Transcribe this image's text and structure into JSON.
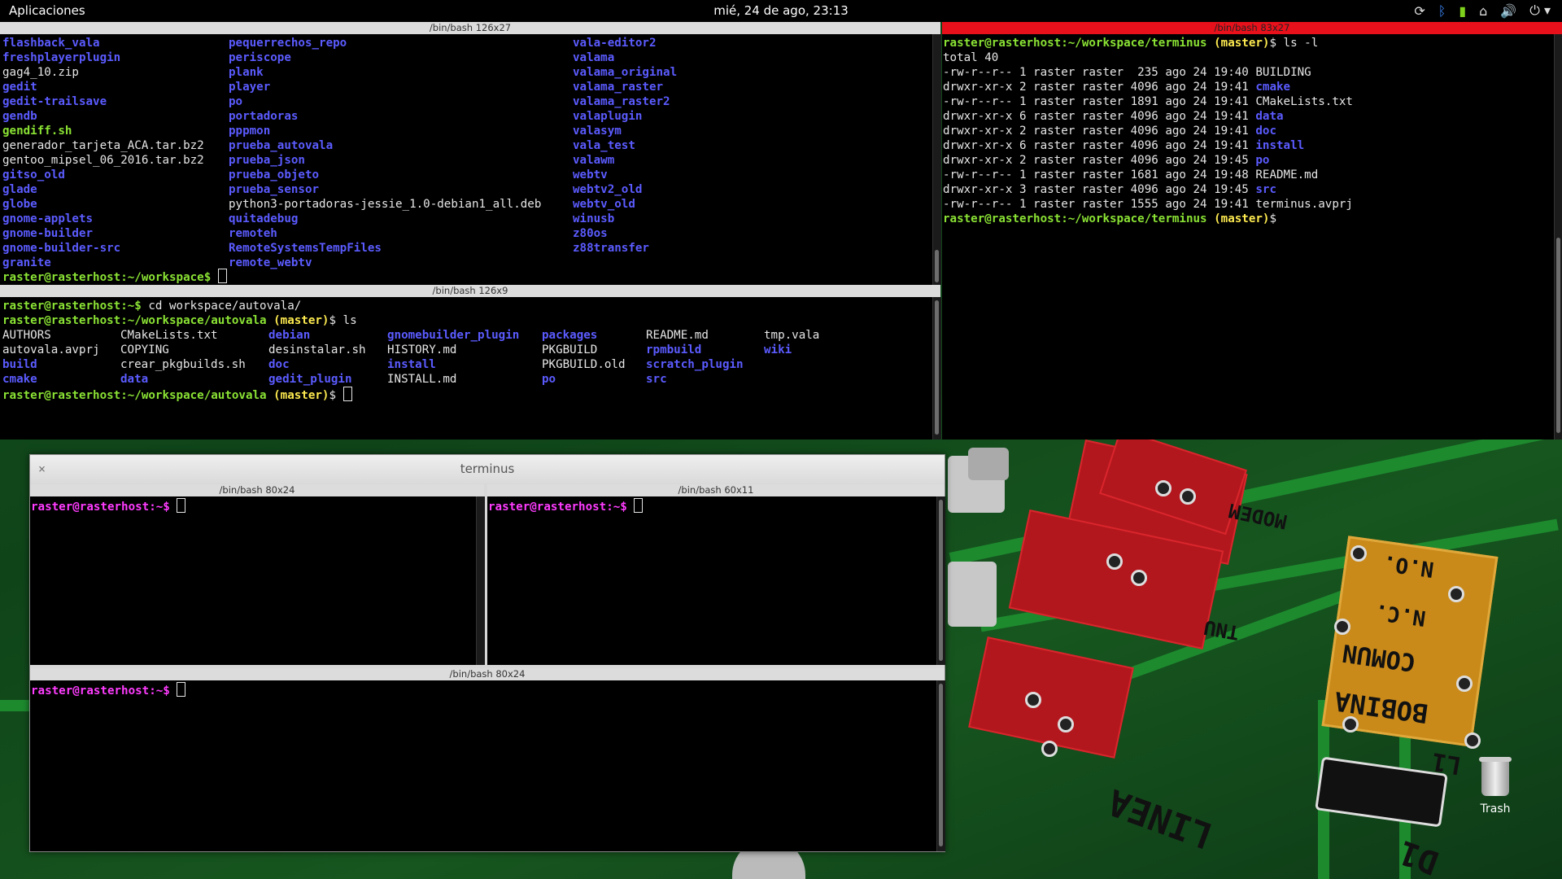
{
  "panel": {
    "apps_label": "Aplicaciones",
    "clock": "mié, 24 de ago, 23:13",
    "tray_icons": [
      "refresh-icon",
      "bluetooth-icon",
      "battery-icon",
      "network-icon",
      "volume-icon",
      "power-icon"
    ]
  },
  "top_left_terminal": {
    "title": "/bin/bash 126x27",
    "col1": [
      "flashback_vala",
      "freshplayerplugin",
      "gag4_10.zip",
      "gedit",
      "gedit-trailsave",
      "gendb",
      "gendiff.sh",
      "generador_tarjeta_ACA.tar.bz2",
      "gentoo_mipsel_06_2016.tar.bz2",
      "gitso_old",
      "glade",
      "globe",
      "gnome-applets",
      "gnome-builder",
      "gnome-builder-src",
      "granite"
    ],
    "col1_colors": [
      "b",
      "b",
      "w",
      "b",
      "b",
      "b",
      "g",
      "w",
      "w",
      "b",
      "b",
      "b",
      "b",
      "b",
      "b",
      "b"
    ],
    "col2": [
      "pequerrechos_repo",
      "periscope",
      "plank",
      "player",
      "po",
      "portadoras",
      "pppmon",
      "prueba_autovala",
      "prueba_json",
      "prueba_objeto",
      "prueba_sensor",
      "python3-portadoras-jessie_1.0-debian1_all.deb",
      "quitadebug",
      "remoteh",
      "RemoteSystemsTempFiles",
      "remote_webtv"
    ],
    "col2_colors": [
      "b",
      "b",
      "b",
      "b",
      "b",
      "b",
      "b",
      "b",
      "b",
      "b",
      "b",
      "w",
      "b",
      "b",
      "b",
      "b"
    ],
    "col3": [
      "vala-editor2",
      "valama",
      "valama_original",
      "valama_raster",
      "valama_raster2",
      "valaplugin",
      "valasym",
      "vala_test",
      "valawm",
      "webtv",
      "webtv2_old",
      "webtv_old",
      "winusb",
      "z80os",
      "z88transfer",
      ""
    ],
    "prompt_user": "raster@rasterhost",
    "prompt_path": ":~/workspace$"
  },
  "mid_left_terminal": {
    "title": "/bin/bash 126x9",
    "line1_user": "raster@rasterhost",
    "line1_path": ":~$",
    "line1_cmd": " cd workspace/autovala/",
    "line2_user": "raster@rasterhost",
    "line2_path": ":~/workspace/autovala",
    "branch": " (master)",
    "line2_cmd": "$ ls",
    "ls_rows": [
      [
        [
          "AUTHORS",
          "w"
        ],
        [
          "CMakeLists.txt",
          "w"
        ],
        [
          "debian",
          "b"
        ],
        [
          "gnomebuilder_plugin",
          "b"
        ],
        [
          "packages",
          "b"
        ],
        [
          "README.md",
          "w"
        ],
        [
          "tmp.vala",
          "w"
        ]
      ],
      [
        [
          "autovala.avprj",
          "w"
        ],
        [
          "COPYING",
          "w"
        ],
        [
          "desinstalar.sh",
          "w"
        ],
        [
          "HISTORY.md",
          "w"
        ],
        [
          "PKGBUILD",
          "w"
        ],
        [
          "rpmbuild",
          "b"
        ],
        [
          "wiki",
          "b"
        ]
      ],
      [
        [
          "build",
          "b"
        ],
        [
          "crear_pkgbuilds.sh",
          "w"
        ],
        [
          "doc",
          "b"
        ],
        [
          "install",
          "b"
        ],
        [
          "PKGBUILD.old",
          "w"
        ],
        [
          "scratch_plugin",
          "b"
        ],
        [
          "",
          ""
        ]
      ],
      [
        [
          "cmake",
          "b"
        ],
        [
          "data",
          "b"
        ],
        [
          "gedit_plugin",
          "b"
        ],
        [
          "INSTALL.md",
          "w"
        ],
        [
          "po",
          "b"
        ],
        [
          "src",
          "b"
        ],
        [
          "",
          ""
        ]
      ]
    ],
    "prompt_end": "$"
  },
  "right_terminal": {
    "title": "/bin/bash 83x27",
    "prompt_user": "raster@rasterhost",
    "prompt_path": ":~/workspace/terminus",
    "branch": " (master)",
    "cmd": "$ ls -l",
    "total": "total 40",
    "entries": [
      {
        "perm": "-rw-r--r-- 1 raster raster  235 ago 24 19:40 ",
        "name": "BUILDING",
        "c": "w"
      },
      {
        "perm": "drwxr-xr-x 2 raster raster 4096 ago 24 19:41 ",
        "name": "cmake",
        "c": "b"
      },
      {
        "perm": "-rw-r--r-- 1 raster raster 1891 ago 24 19:41 ",
        "name": "CMakeLists.txt",
        "c": "w"
      },
      {
        "perm": "drwxr-xr-x 6 raster raster 4096 ago 24 19:41 ",
        "name": "data",
        "c": "b"
      },
      {
        "perm": "drwxr-xr-x 2 raster raster 4096 ago 24 19:41 ",
        "name": "doc",
        "c": "b"
      },
      {
        "perm": "drwxr-xr-x 6 raster raster 4096 ago 24 19:41 ",
        "name": "install",
        "c": "b"
      },
      {
        "perm": "drwxr-xr-x 2 raster raster 4096 ago 24 19:45 ",
        "name": "po",
        "c": "b"
      },
      {
        "perm": "-rw-r--r-- 1 raster raster 1681 ago 24 19:48 ",
        "name": "README.md",
        "c": "w"
      },
      {
        "perm": "drwxr-xr-x 3 raster raster 4096 ago 24 19:45 ",
        "name": "src",
        "c": "b"
      },
      {
        "perm": "-rw-r--r-- 1 raster raster 1555 ago 24 19:41 ",
        "name": "terminus.avprj",
        "c": "w"
      }
    ],
    "prompt_end": "$"
  },
  "terminus_window": {
    "title": "terminus",
    "close": "×",
    "pane_a": {
      "title": "/bin/bash 80x24",
      "user": "raster@rasterhost",
      "path": ":~$"
    },
    "pane_b": {
      "title": "/bin/bash 60x11",
      "user": "raster@rasterhost",
      "path": ":~$"
    },
    "pane_c": {
      "title": "/bin/bash 80x24",
      "user": "raster@rasterhost",
      "path": ":~$"
    }
  },
  "desktop": {
    "trash_label": "Trash",
    "silk": [
      "MODEM",
      "N.O.",
      "N.C.",
      "COMUN",
      "BOBINA",
      "LINEA",
      "D1",
      "L1",
      "TNU"
    ]
  },
  "colors": {
    "active_titlebar": "#e8101a",
    "prompt_green": "#8ae234",
    "dir_blue": "#5b5bff",
    "prompt_magenta": "#ff3cff",
    "branch_yellow": "#fce94f"
  }
}
